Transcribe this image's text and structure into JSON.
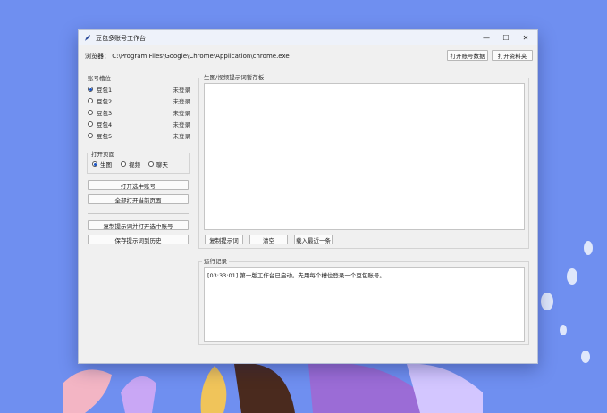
{
  "window": {
    "title": "豆包多账号工作台",
    "controls": {
      "minimize": "—",
      "maximize": "☐",
      "close": "✕"
    }
  },
  "browser": {
    "label": "浏览器：",
    "path": "C:\\Program Files\\Google\\Chrome\\Application\\chrome.exe"
  },
  "top_buttons": {
    "open_data": "打开账号数据",
    "open_folder": "打开资料夹"
  },
  "accounts": {
    "label": "账号槽位",
    "items": [
      {
        "name": "豆包1",
        "status": "未登录",
        "selected": true
      },
      {
        "name": "豆包2",
        "status": "未登录",
        "selected": false
      },
      {
        "name": "豆包3",
        "status": "未登录",
        "selected": false
      },
      {
        "name": "豆包4",
        "status": "未登录",
        "selected": false
      },
      {
        "name": "豆包5",
        "status": "未登录",
        "selected": false
      }
    ]
  },
  "open_page": {
    "label": "打开页面",
    "options": [
      {
        "label": "生图",
        "selected": true
      },
      {
        "label": "视频",
        "selected": false
      },
      {
        "label": "聊天",
        "selected": false
      }
    ]
  },
  "left_buttons": {
    "open_selected": "打开选中账号",
    "open_all": "全部打开当前页面",
    "copy_prompt_open": "复制提示词并打开选中账号",
    "save_prompt_history": "保存提示词到历史"
  },
  "prompt_box": {
    "label": "生图/视频提示词暂存板",
    "value": "",
    "buttons": {
      "copy": "复制提示词",
      "clear": "清空",
      "load_last": "载入最近一条"
    }
  },
  "log": {
    "label": "运行记录",
    "entries": [
      "[03:33:01] 第一版工作台已启动。先用每个槽位登录一个豆包账号。"
    ]
  }
}
